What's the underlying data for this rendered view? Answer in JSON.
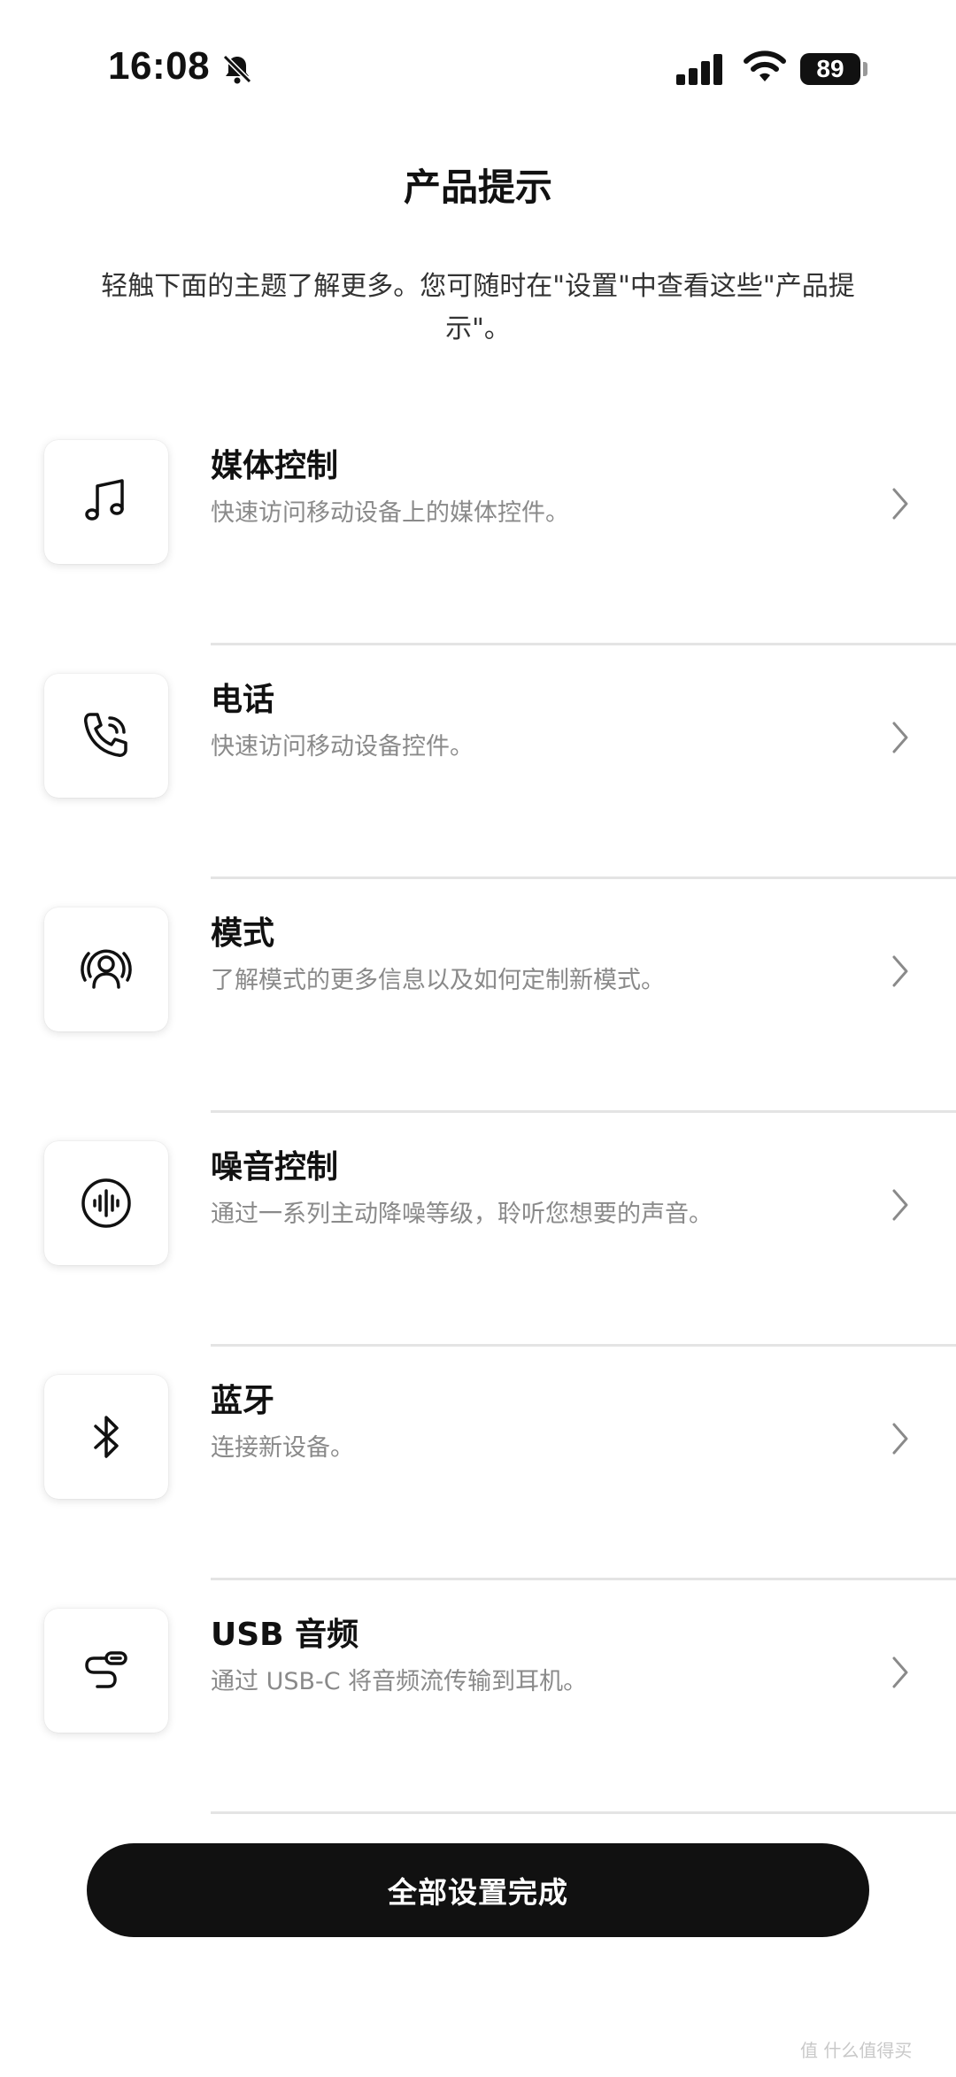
{
  "status_bar": {
    "time": "16:08",
    "battery": "89",
    "icons": [
      "bell-slash-icon",
      "cellular-signal-icon",
      "wifi-icon",
      "battery-icon"
    ]
  },
  "header": {
    "title": "产品提示",
    "intro": "轻触下面的主题了解更多。您可随时在\"设置\"中查看这些\"产品提示\"。"
  },
  "items": [
    {
      "title": "媒体控制",
      "subtitle": "快速访问移动设备上的媒体控件。",
      "icon": "music-note-icon"
    },
    {
      "title": "电话",
      "subtitle": "快速访问移动设备控件。",
      "icon": "phone-calling-icon"
    },
    {
      "title": "模式",
      "subtitle": "了解模式的更多信息以及如何定制新模式。",
      "icon": "person-immersive-icon"
    },
    {
      "title": "噪音控制",
      "subtitle": "通过一系列主动降噪等级，聆听您想要的声音。",
      "icon": "sound-wave-icon"
    },
    {
      "title": "蓝牙",
      "subtitle": "连接新设备。",
      "icon": "bluetooth-icon"
    },
    {
      "title": "USB 音频",
      "subtitle": "通过 USB-C 将音频流传输到耳机。",
      "icon": "usb-c-cable-icon"
    }
  ],
  "done_button": {
    "label": "全部设置完成"
  },
  "watermark": "值 什么值得买"
}
